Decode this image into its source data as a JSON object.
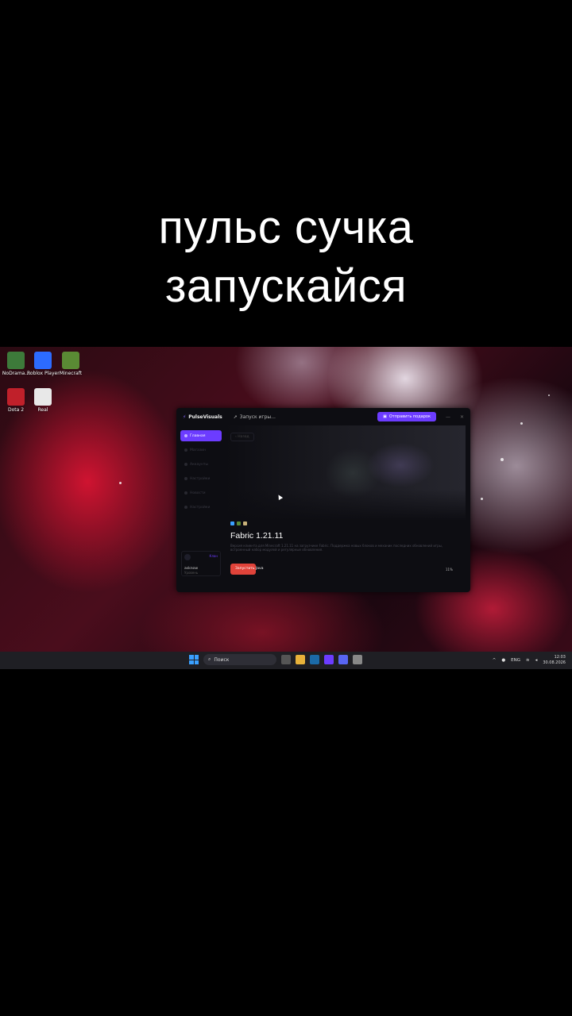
{
  "caption": {
    "line1": "пульс сучка",
    "line2": "запускайся"
  },
  "desktop_icons": [
    {
      "label": "NoDrama...",
      "icon": "game-shield-icon",
      "color": "#3d7a3a"
    },
    {
      "label": "Roblox Player",
      "icon": "roblox-icon",
      "color": "#2c6bff"
    },
    {
      "label": "Minecraft",
      "icon": "minecraft-grass-icon",
      "color": "#5a8a34"
    },
    {
      "label": "Dota 2",
      "icon": "dota2-icon",
      "color": "#c0202a"
    },
    {
      "label": "Real",
      "icon": "real-app-icon",
      "color": "#e8e8e8"
    }
  ],
  "launcher": {
    "brand": "PulseVisuals",
    "launch_status": "Запуск игры...",
    "gift_button": "Отправить подарок",
    "nav": [
      {
        "label": "Главная",
        "active": true
      },
      {
        "label": "Магазин",
        "active": false
      },
      {
        "label": "Аккаунты",
        "active": false
      },
      {
        "label": "Настройки",
        "active": false
      },
      {
        "label": "Новости",
        "active": false
      },
      {
        "label": "Настройки",
        "active": false
      }
    ],
    "user": {
      "status": "Клан",
      "name": "asknow",
      "level": "Уровень"
    },
    "back_label": "Назад",
    "game_title": "Fabric 1.21.11",
    "description": "Версия клиента для Minecraft 1.21.11 на загрузчике Fabric. Поддержка новых блоков и механик последних обновлений игры, встроенный набор модулей и регулярные обновления.",
    "play_label": "Запустить Java",
    "progress_percent": "11%",
    "progress_fraction": 0.11
  },
  "taskbar": {
    "search_placeholder": "Поиск",
    "language": "ENG",
    "time": "12:03",
    "date": "30.08.2026"
  },
  "colors": {
    "accent": "#6c3cff",
    "play": "#e0433a",
    "taskbar": "#1f1f24"
  }
}
